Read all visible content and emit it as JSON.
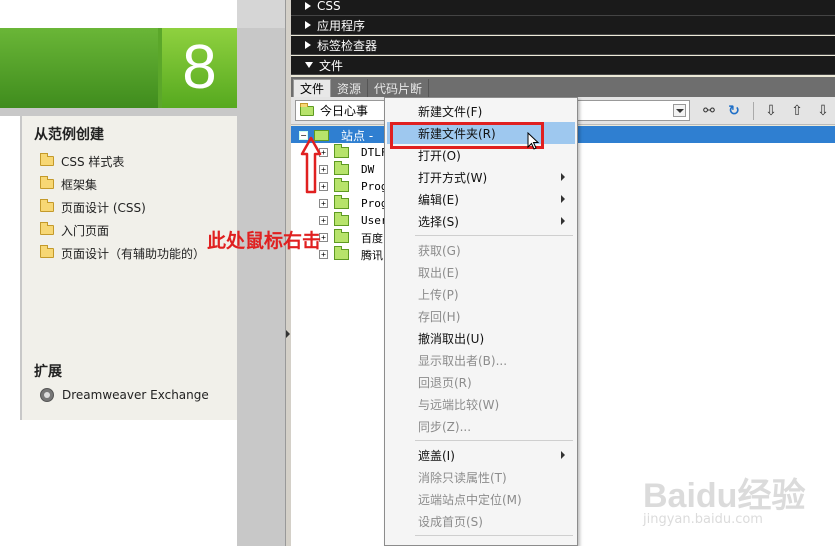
{
  "start_page": {
    "banner_number": "8",
    "create_section": {
      "title": "从范例创建",
      "items": [
        "CSS 样式表",
        "框架集",
        "页面设计 (CSS)",
        "入门页面",
        "页面设计（有辅助功能的）"
      ]
    },
    "extend_section": {
      "title": "扩展",
      "exchange_label": "Dreamweaver Exchange"
    }
  },
  "annotation": "此处鼠标右击",
  "panels": {
    "headers": [
      "CSS",
      "应用程序",
      "标签检查器",
      "文件"
    ],
    "tabs": [
      "文件",
      "资源",
      "代码片断"
    ],
    "site_select_value": "今日心事"
  },
  "tree": {
    "root_label": "站点 -",
    "rows": [
      "DTLF",
      "DW",
      "Prog",
      "Prog",
      "User",
      "百度",
      "腾讯"
    ]
  },
  "context_menu": {
    "items": [
      {
        "label": "新建文件(F)",
        "disabled": false,
        "submenu": false
      },
      {
        "label": "新建文件夹(R)",
        "disabled": false,
        "submenu": false,
        "highlight": true
      },
      {
        "label": "打开(O)",
        "disabled": false,
        "submenu": false
      },
      {
        "label": "打开方式(W)",
        "disabled": false,
        "submenu": true
      },
      {
        "label": "编辑(E)",
        "disabled": false,
        "submenu": true
      },
      {
        "label": "选择(S)",
        "disabled": false,
        "submenu": true
      },
      {
        "label": "获取(G)",
        "disabled": true,
        "submenu": false
      },
      {
        "label": "取出(E)",
        "disabled": true,
        "submenu": false
      },
      {
        "label": "上传(P)",
        "disabled": true,
        "submenu": false
      },
      {
        "label": "存回(H)",
        "disabled": true,
        "submenu": false
      },
      {
        "label": "撤消取出(U)",
        "disabled": false,
        "submenu": false
      },
      {
        "label": "显示取出者(B)...",
        "disabled": true,
        "submenu": false
      },
      {
        "label": "回退页(R)",
        "disabled": true,
        "submenu": false
      },
      {
        "label": "与远端比较(W)",
        "disabled": true,
        "submenu": false
      },
      {
        "label": "同步(Z)...",
        "disabled": true,
        "submenu": false
      },
      {
        "label": "遮盖(I)",
        "disabled": false,
        "submenu": true
      },
      {
        "label": "消除只读属性(T)",
        "disabled": true,
        "submenu": false
      },
      {
        "label": "远端站点中定位(M)",
        "disabled": true,
        "submenu": false
      },
      {
        "label": "设成首页(S)",
        "disabled": true,
        "submenu": false
      }
    ]
  },
  "watermark": {
    "logo": "Baidu经验",
    "url": "jingyan.baidu.com"
  },
  "colors": {
    "highlight_red": "#e02020",
    "selection_blue": "#2f7fd1",
    "menu_hover": "#9ec8ef"
  }
}
